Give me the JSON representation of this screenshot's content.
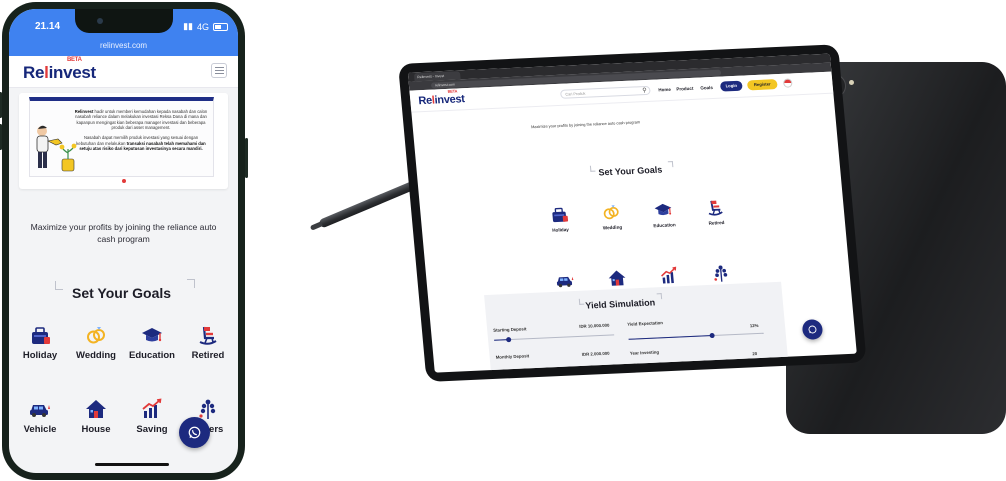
{
  "brand": {
    "name_start": "Re",
    "name_mark": "l",
    "name_end": "invest",
    "badge": "BETA"
  },
  "colors": {
    "primary": "#1d2a7f",
    "accent": "#e23a3a",
    "status_bar": "#3f82f0",
    "login": "#1d2a7f",
    "register": "#f3c623"
  },
  "phone": {
    "status_time": "21.14",
    "status_signal": "4G",
    "url": "relinvest.com",
    "banner": {
      "text_1_bold": "Relinvest",
      "text_1": "hadir untuk memberi kemudahan kepada nasabah dan calon nasabah reliance dalam melakukan investasi Reksa Dana di mana dan kapanpun mengingat kian beberapa manager investasi dan beberapa produk dari asset management.",
      "text_2": "Nasabah dapat memilih produk investasi yang sesuai dengan kebutuhan dan melakukan",
      "text_2_bold": "transaksi nasabah telah memahami dan setuju atas risiko dari keputusan investasinya secara mandiri."
    },
    "tagline": "Maximize your profits by joining the reliance auto cash program",
    "goals_title": "Set Your Goals",
    "goals": [
      {
        "label": "Holiday",
        "icon": "suitcase-icon"
      },
      {
        "label": "Wedding",
        "icon": "rings-icon"
      },
      {
        "label": "Education",
        "icon": "graduation-cap-icon"
      },
      {
        "label": "Retired",
        "icon": "rocking-chair-icon"
      },
      {
        "label": "Vehicle",
        "icon": "car-icon"
      },
      {
        "label": "House",
        "icon": "house-icon"
      },
      {
        "label": "Saving",
        "icon": "chart-up-icon"
      },
      {
        "label": "Others",
        "icon": "plant-icon"
      }
    ]
  },
  "tablet": {
    "tab_title": "Relinvest - Invest",
    "address": "relinvest.com",
    "search_placeholder": "Cari Produk",
    "nav": {
      "home": "Home",
      "product": "Product",
      "goals": "Goals",
      "login": "Login",
      "register": "Register"
    },
    "tagline": "Maximize your profits by joining the reliance auto cash program",
    "goals_title": "Set Your Goals",
    "yield": {
      "title": "Yield Simulation",
      "starting_deposit_label": "Starting Deposit",
      "starting_deposit_value": "IDR 10.000.000",
      "yield_expectation_label": "Yield Expectation",
      "yield_expectation_value": "12%",
      "monthly_deposit_label": "Monthly Deposit",
      "monthly_deposit_value": "IDR 2.000.000",
      "year_investing_label": "Year Investing",
      "year_investing_value": "20",
      "starting_deposit_fraction": 0.12,
      "yield_fraction": 0.62
    }
  }
}
